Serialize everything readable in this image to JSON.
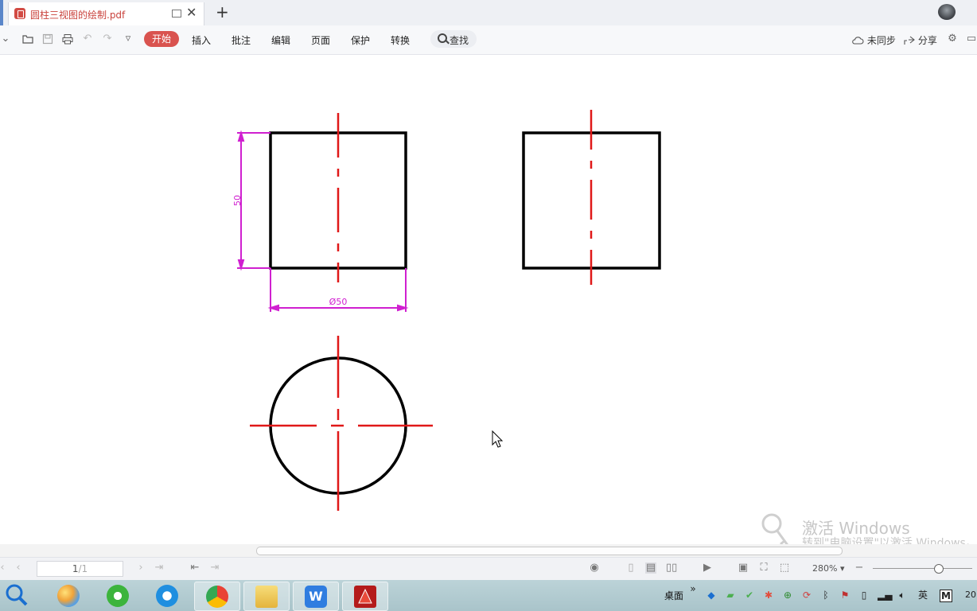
{
  "tab": {
    "title": "圆柱三视图的绘制.pdf",
    "new_tab": "+"
  },
  "toolbar": {
    "menus": [
      "开始",
      "插入",
      "批注",
      "编辑",
      "页面",
      "保护",
      "转换"
    ],
    "search_label": "查找",
    "sync_label": "未同步",
    "share_label": "分享"
  },
  "drawing": {
    "colors": {
      "outline": "#000000",
      "centerline": "#e01818",
      "dimension": "#d020d0"
    },
    "dim_height": "50",
    "dim_diameter": "Ø50"
  },
  "status": {
    "page": "1",
    "page_total": "/1",
    "zoom": "280%",
    "zoom_arrow": "▾"
  },
  "taskbar": {
    "desktop_label": "桌面",
    "ime_label": "英",
    "clock_partial": "20"
  },
  "watermark": {
    "line1": "激活 Windows",
    "line2": "转到\"电脑设置\"以激活 Windows。"
  }
}
